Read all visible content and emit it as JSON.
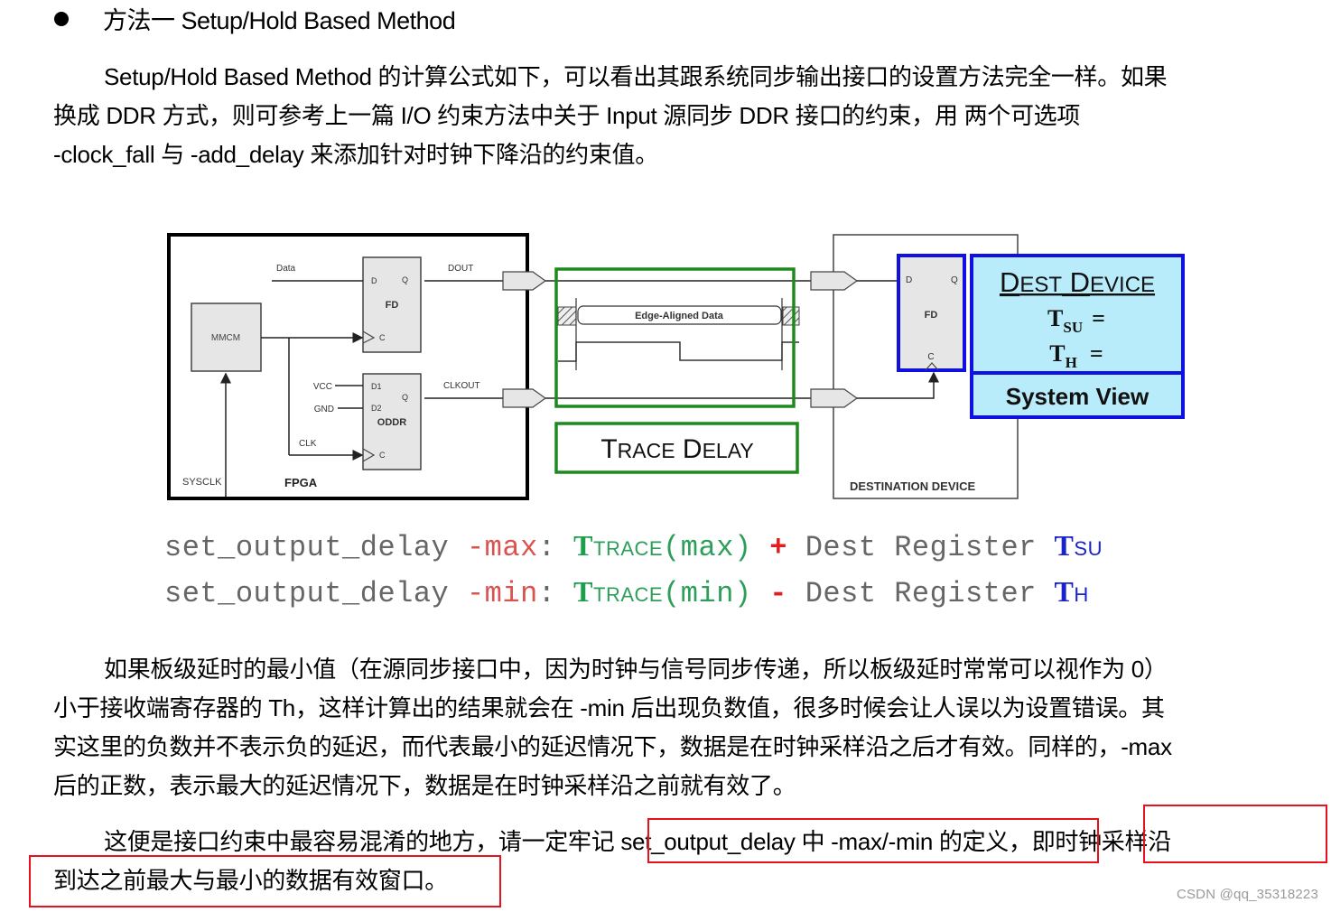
{
  "heading": {
    "bullet_icon": "bullet-dot",
    "text": "方法一 Setup/Hold Based Method"
  },
  "intro_paragraph": {
    "lines": [
      "Setup/Hold Based Method 的计算公式如下，可以看出其跟系统同步输出接口的设置方法完全一样。如果",
      "换成 DDR 方式，则可参考上一篇 I/O 约束方法中关于 Input 源同步 DDR 接口的约束，用  两个可选项",
      "-clock_fall 与  -add_delay 来添加针对时钟下降沿的约束值。"
    ]
  },
  "diagram": {
    "fpga": {
      "label": "FPGA",
      "sysclk": "SYSCLK",
      "mmcm": "MMCM",
      "fd": {
        "name": "FD",
        "d": "D",
        "q": "Q",
        "c": "C"
      },
      "oddr": {
        "name": "ODDR",
        "d1": "D1",
        "d2": "D2",
        "q": "Q",
        "c": "C"
      },
      "data": "Data",
      "vcc": "VCC",
      "gnd": "GND",
      "clk": "CLK",
      "dout": "DOUT",
      "clkout": "CLKOUT"
    },
    "trace": {
      "waveform_label": "Edge-Aligned Data",
      "trace_delay_label": "TRACE DELAY",
      "color": "#1e8a1e"
    },
    "destination": {
      "label": "DESTINATION DEVICE",
      "fd": {
        "name": "FD",
        "d": "D",
        "q": "Q",
        "c": "C"
      },
      "callout": {
        "title": "DEST DEVICE",
        "tsu": "T",
        "tsu_sub": "SU",
        "th": "T",
        "th_sub": "H",
        "equals": "=",
        "system_view": "System View",
        "fill": "#b8ecfa",
        "border": "#1010e0"
      }
    }
  },
  "formulas": [
    {
      "cmd": "set_output_delay",
      "flag": "-max",
      "colon": ":",
      "t": "T",
      "t_sub": "TRACE",
      "arg": "(max)",
      "op": "+",
      "rest": "Dest Register",
      "reg_t": "T",
      "reg_sub": "SU"
    },
    {
      "cmd": "set_output_delay",
      "flag": "-min",
      "colon": ":",
      "t": "T",
      "t_sub": "TRACE",
      "arg": "(min)",
      "op": "-",
      "rest": "Dest Register",
      "reg_t": "T",
      "reg_sub": "H"
    }
  ],
  "explanation_paragraph": {
    "lines": [
      "如果板级延时的最小值（在源同步接口中，因为时钟与信号同步传递，所以板级延时常常可以视作为 0）",
      "小于接收端寄存器的 Th，这样计算出的结果就会在  -min  后出现负数值，很多时候会让人误以为设置错误。其",
      "实这里的负数并不表示负的延迟，而代表最小的延迟情况下，数据是在时钟采样沿之后才有效。同样的，-max",
      "后的正数，表示最大的延迟情况下，数据是在时钟采样沿之前就有效了。"
    ]
  },
  "conclusion_paragraph": {
    "line1_prefix": "这便是接口约束中最容易混淆的地方，请一定牢记 ",
    "line1_highlight": "set_output_delay 中  -max/-min 的定义",
    "line1_mid": "，即",
    "line1_highlight2": "时钟采样沿",
    "line2_highlight": "到达之前最大与最小的数据有效窗口。",
    "highlight_color": "#e8101c"
  },
  "watermark": "CSDN @qq_35318223"
}
